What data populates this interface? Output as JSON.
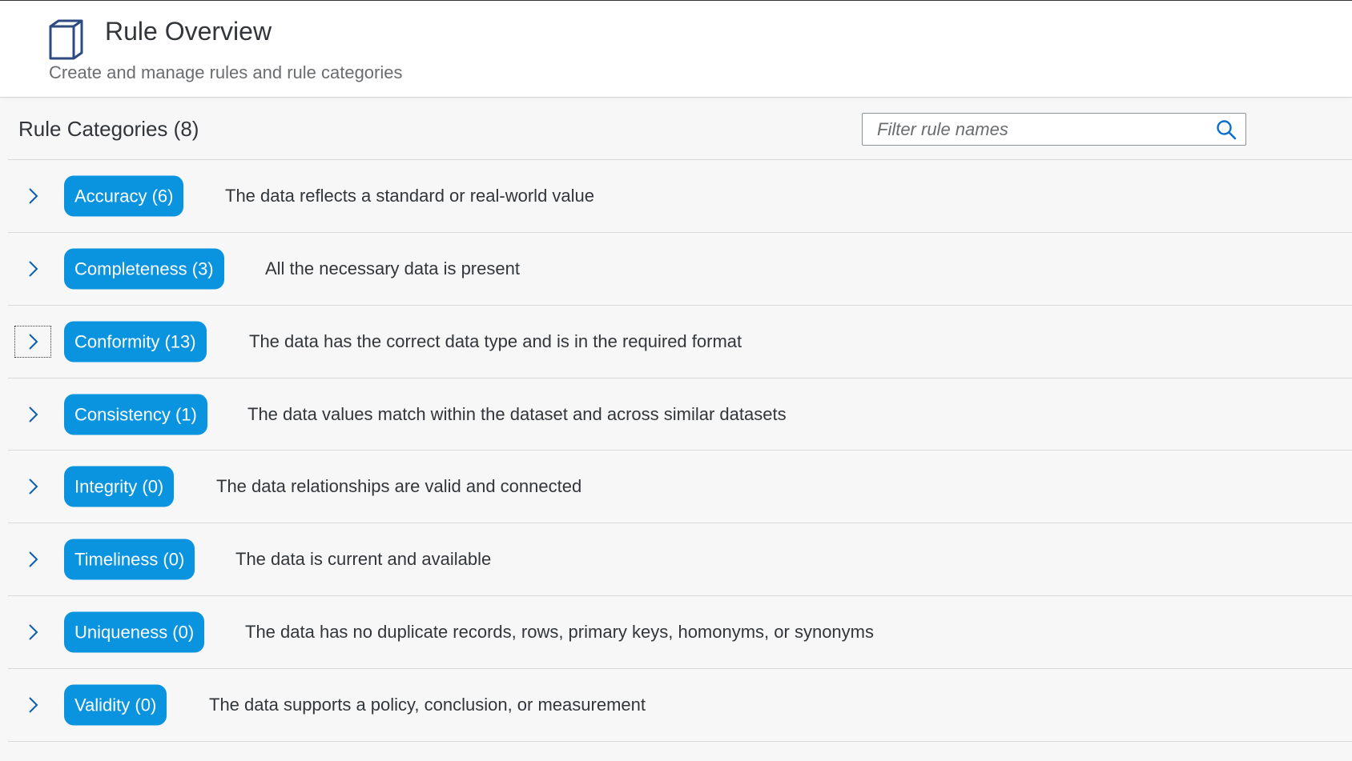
{
  "header": {
    "icon": "book-icon",
    "title": "Rule Overview",
    "subtitle": "Create and manage rules and rule categories"
  },
  "toolbar": {
    "categories_title": "Rule Categories (8)",
    "filter_placeholder": "Filter rule names",
    "filter_value": "",
    "search_icon": "search-icon"
  },
  "colors": {
    "accent": "#0a93df",
    "text": "#32363a",
    "subtle_text": "#6a6d70"
  },
  "categories": [
    {
      "label": "Accuracy (6)",
      "description": "The data reflects a standard or real-world value"
    },
    {
      "label": "Completeness (3)",
      "description": "All the necessary data is present"
    },
    {
      "label": "Conformity (13)",
      "description": "The data has the correct data type and is in the required format"
    },
    {
      "label": "Consistency (1)",
      "description": "The data values match within the dataset and across similar datasets"
    },
    {
      "label": "Integrity (0)",
      "description": "The data relationships are valid and connected"
    },
    {
      "label": "Timeliness (0)",
      "description": "The data is current and available"
    },
    {
      "label": "Uniqueness (0)",
      "description": "The data has no duplicate records, rows, primary keys, homonyms, or synonyms"
    },
    {
      "label": "Validity (0)",
      "description": "The data supports a policy, conclusion, or measurement"
    }
  ]
}
